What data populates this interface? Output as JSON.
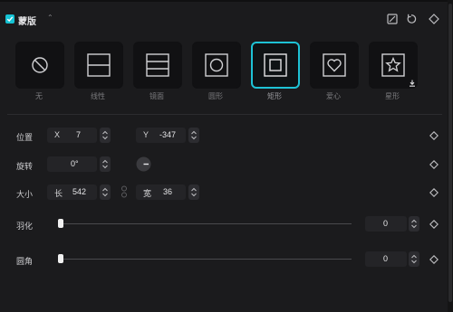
{
  "panel": {
    "title": "蒙版"
  },
  "shapes": [
    {
      "label": "无",
      "icon": "none-icon",
      "selected": false
    },
    {
      "label": "线性",
      "icon": "linear-icon",
      "selected": false
    },
    {
      "label": "镜面",
      "icon": "mirror-icon",
      "selected": false
    },
    {
      "label": "圆形",
      "icon": "circle-icon",
      "selected": false
    },
    {
      "label": "矩形",
      "icon": "rectangle-icon",
      "selected": true
    },
    {
      "label": "爱心",
      "icon": "heart-icon",
      "selected": false
    },
    {
      "label": "星形",
      "icon": "star-icon",
      "selected": false
    }
  ],
  "position": {
    "label": "位置",
    "x_prefix": "X",
    "x_value": "7",
    "y_prefix": "Y",
    "y_value": "-347"
  },
  "rotation": {
    "label": "旋转",
    "value": "0°"
  },
  "size": {
    "label": "大小",
    "w_prefix": "长",
    "w_value": "542",
    "h_prefix": "宽",
    "h_value": "36"
  },
  "feather": {
    "label": "羽化",
    "value": "0",
    "level": 0
  },
  "round": {
    "label": "圆角",
    "value": "0",
    "level": 0
  },
  "colors": {
    "accent": "#1ec3d6",
    "background": "#1b1b1d",
    "field": "#242427"
  }
}
